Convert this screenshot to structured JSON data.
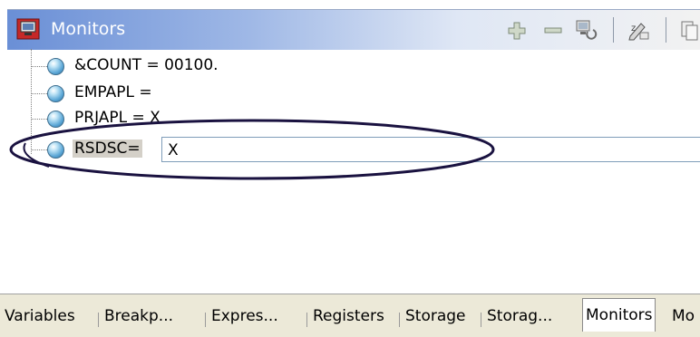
{
  "view": {
    "title": "Monitors",
    "toolbar": {
      "add_icon": "plus-icon",
      "remove_icon": "minus-icon",
      "monitor_icon": "monitor-icon",
      "edit_icon": "edit-icon",
      "copy_icon": "copy-icon"
    }
  },
  "monitors": [
    {
      "label": "&COUNT = 00100."
    },
    {
      "label": "EMPAPL ="
    },
    {
      "label": "PRJAPL = X"
    },
    {
      "label": "RSDSC=",
      "edit_value": "X"
    }
  ],
  "tabs": [
    {
      "label": "Variables"
    },
    {
      "label": "Breakp..."
    },
    {
      "label": "Expres..."
    },
    {
      "label": "Registers"
    },
    {
      "label": "Storage"
    },
    {
      "label": "Storag..."
    },
    {
      "label": "Monitors",
      "active": true
    },
    {
      "label": "Mo"
    }
  ],
  "colors": {
    "title_gradient_start": "#6a8fd6",
    "annotation_oval": "#1a1240",
    "tab_background": "#ece9d8"
  }
}
